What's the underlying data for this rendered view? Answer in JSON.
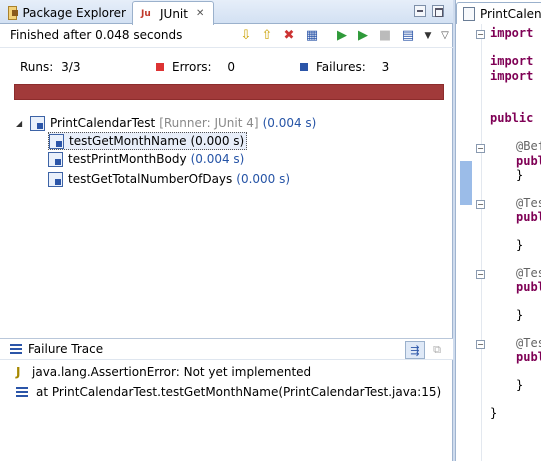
{
  "tabs": {
    "package_explorer": "Package Explorer",
    "junit": "JUnit"
  },
  "toolbar": {
    "status": "Finished after 0.048 seconds"
  },
  "counters": {
    "runs_label": "Runs:",
    "runs_value": "3/3",
    "errors_label": "Errors:",
    "errors_value": "0",
    "failures_label": "Failures:",
    "failures_value": "3"
  },
  "progress": {
    "fraction": 1.0,
    "color": "#a13a3a"
  },
  "tree": {
    "suite": {
      "name": "PrintCalendarTest",
      "runner": "[Runner: JUnit 4]",
      "time": "(0.004 s)"
    },
    "tests": [
      {
        "name": "testGetMonthName",
        "time": "(0.000 s)"
      },
      {
        "name": "testPrintMonthBody",
        "time": "(0.004 s)"
      },
      {
        "name": "testGetTotalNumberOfDays",
        "time": "(0.000 s)"
      }
    ]
  },
  "failure_trace": {
    "title": "Failure Trace",
    "lines": [
      "java.lang.AssertionError: Not yet implemented",
      "at PrintCalendarTest.testGetMonthName(PrintCalendarTest.java:15)"
    ]
  },
  "editor": {
    "tab_title": "PrintCalendarTest.java",
    "code": [
      {
        "kw": "import",
        "text": " s"
      },
      {
        "kw": "import",
        "text": " c"
      },
      {
        "kw": "import",
        "text": " c"
      },
      {
        "kw": "public",
        "text": " c"
      },
      {
        "ann": "@Bef"
      },
      {
        "kw": "publi",
        "text": ""
      },
      {
        "text": "}"
      },
      {
        "ann": "@Tes"
      },
      {
        "kw": "publi",
        "text": ""
      },
      {
        "text": "}"
      },
      {
        "ann": "@Tes"
      },
      {
        "kw": "publi",
        "text": ""
      },
      {
        "text": "}"
      },
      {
        "ann": "@Tes"
      },
      {
        "kw": "publi",
        "text": ""
      },
      {
        "text": "}"
      },
      {
        "text": "}"
      }
    ]
  }
}
